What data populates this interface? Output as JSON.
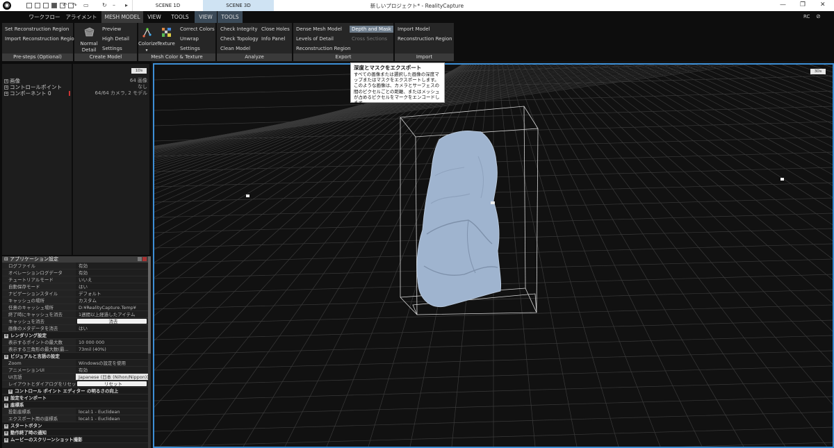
{
  "titlebar": {
    "window_title": "新しいプロジェクト* - RealityCapture",
    "tabs": [
      {
        "label": "SCENE 1D"
      },
      {
        "label": "SCENE 3D"
      }
    ],
    "user": "RC",
    "window_controls": {
      "minimize": "—",
      "maximize": "❐",
      "close": "✕"
    }
  },
  "menubar": {
    "items": [
      {
        "label": "ワークフロー"
      },
      {
        "label": "アライメント"
      },
      {
        "label": "MESH MODEL",
        "active": true
      },
      {
        "label": "VIEW"
      },
      {
        "label": "TOOLS"
      },
      {
        "label": "VIEW"
      },
      {
        "label": "TOOLS"
      }
    ]
  },
  "ribbon": {
    "presteps": {
      "label": "Pre-steps (Optional)",
      "items": [
        "Set Reconstruction Region",
        "Import Reconstruction Region"
      ]
    },
    "create_model": {
      "label": "Create Model",
      "big": "Normal Detail",
      "items": [
        "Preview",
        "High Detail",
        "Settings"
      ]
    },
    "mesh_color": {
      "label": "Mesh Color & Texture",
      "big1": "Colorize",
      "big2": "Texture",
      "items": [
        "Correct Colors",
        "Unwrap",
        "Settings"
      ]
    },
    "analyze": {
      "label": "Analyze",
      "col1": [
        "Check Integrity",
        "Check Topology",
        "Clean Model"
      ],
      "col2": [
        "Close Holes",
        "Info Panel"
      ]
    },
    "export": {
      "label": "Export",
      "col1": [
        "Dense Mesh Model",
        "Levels of Detail",
        "Reconstruction Region"
      ],
      "col2": [
        "Depth and Mask",
        "Cross Sections"
      ]
    },
    "import": {
      "label": "Import",
      "items": [
        "Import Model",
        "Reconstruction Region"
      ]
    }
  },
  "tree": {
    "items": [
      "画像",
      "コントロールポイント",
      "コンポーネント 0"
    ],
    "badge": "1Ds",
    "info": [
      "64 画像",
      "なし",
      "64/64 カメラ, 2 モデル"
    ]
  },
  "settings": {
    "title": "アプリケーション設定",
    "rows": [
      {
        "k": "ログファイル",
        "v": "有効"
      },
      {
        "k": "オペレーションログデータ",
        "v": "有効"
      },
      {
        "k": "チュートリアルモード",
        "v": "いいえ"
      },
      {
        "k": "自動保存モード",
        "v": "はい"
      },
      {
        "k": "ナビゲーションスタイル",
        "v": "デフォルト"
      },
      {
        "k": "キャッシュの場所",
        "v": "カスタム"
      },
      {
        "k": "任意のキャッシュ場所",
        "v": "D:¥RealityCapture.Temp¥"
      },
      {
        "k": "終了時にキャッシュを消去",
        "v": "1週間以上経過したアイテム"
      },
      {
        "k": "キャッシュを消去",
        "v": "消去",
        "type": "btn"
      },
      {
        "k": "画像のメタデータを消去",
        "v": "はい"
      },
      {
        "k": "レンダリング設定",
        "type": "head"
      },
      {
        "k": "表示するポイントの最大数",
        "v": "10 000 000"
      },
      {
        "k": "表示する三角形の最大数(最...",
        "v": "73mil (40%)"
      },
      {
        "k": "ビジュアルと言語の設定",
        "type": "head"
      },
      {
        "k": "Zoom",
        "v": "Windowsの設定を使用"
      },
      {
        "k": "アニメーションUI",
        "v": "有効"
      },
      {
        "k": "UI言語",
        "v": "Japanese (日本 (Nihon/Nippon))",
        "type": "sel"
      },
      {
        "k": "レイアウトとダイアログをリセット",
        "v": "リセット",
        "type": "btn"
      },
      {
        "k": "コントロール ポイント エディター の明るさの向上",
        "type": "head2"
      },
      {
        "k": "設定をインポート",
        "type": "head"
      },
      {
        "k": "座標系",
        "type": "head"
      },
      {
        "k": "投影座標系",
        "v": "local:1 - Euclidean"
      },
      {
        "k": "エクスポート用の座標系",
        "v": "local:1 - Euclidean"
      },
      {
        "k": "スタートボタン",
        "type": "head"
      },
      {
        "k": "動作終了時の通知",
        "type": "head"
      },
      {
        "k": "ムービーのスクリーンショット撮影",
        "type": "head"
      }
    ]
  },
  "viewport": {
    "badge": "3Ds"
  },
  "tooltip": {
    "title": "深度とマスクをエクスポート",
    "body": "すべての画像または選択した画像の深度マップまたはマスクをエクスポートします。このような画像は、カメラとサーフェスの間のピクセルごとの距離、またはメッシュが占めるピクセルをマークをエンコードします。"
  },
  "colors": {
    "accent": "#3d8fd6",
    "ribbon_hl": "#6e7d8c",
    "model": "#9fb4cf"
  }
}
